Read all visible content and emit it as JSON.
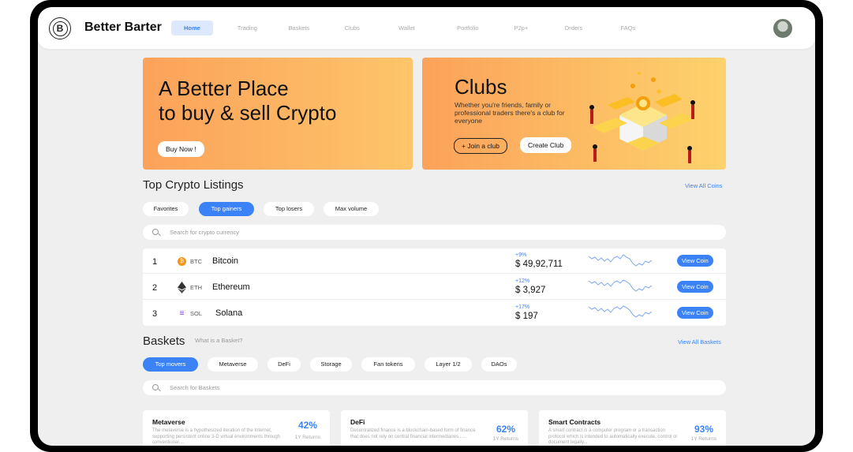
{
  "nav": {
    "logo_letter": "B",
    "brand": "Better Barter",
    "items": [
      "Home",
      "Trading",
      "Baskets",
      "Clubs",
      "Wallet",
      "Portfolio",
      "P2p+",
      "Orders",
      "FAQs"
    ]
  },
  "hero": {
    "title_line1": "A Better Place",
    "title_line2": "to buy & sell Crypto",
    "button": "Buy Now !"
  },
  "clubs": {
    "title": "Clubs",
    "description": "Whether you're friends, family or professional traders there's a club for everyone",
    "join_button": "+ Join a club",
    "create_button": "Create Club"
  },
  "listings": {
    "title": "Top Crypto Listings",
    "view_all": "View All Coins",
    "filters": [
      "Favorites",
      "Top gainers",
      "Top losers",
      "Max volume"
    ],
    "search_placeholder": "Search for crypto currency",
    "rows": [
      {
        "rank": "1",
        "symbol": "BTC",
        "name": "Bitcoin",
        "change": "+9%",
        "price": "$ 49,92,711",
        "button": "View Coin"
      },
      {
        "rank": "2",
        "symbol": "ETH",
        "name": "Ethereum",
        "change": "+12%",
        "price": "$ 3,927",
        "button": "View Coin"
      },
      {
        "rank": "3",
        "symbol": "SOL",
        "name": "Solana",
        "change": "+17%",
        "price": "$ 197",
        "button": "View Coin"
      }
    ]
  },
  "baskets": {
    "title": "Baskets",
    "subtitle": "What is a Basket?",
    "view_all": "View All Baskets",
    "filters": [
      "Top movers",
      "Metaverse",
      "DeFi",
      "Storage",
      "Fan tokens",
      "Layer 1/2",
      "DAOs"
    ],
    "search_placeholder": "Search for Baskets",
    "cards": [
      {
        "title": "Metaverse",
        "desc": "The metaverse is a hypothesized iteration of the Internet, supporting persistent online 3-D virtual environments through conventional....",
        "pct": "42%",
        "ret": "1Y Returns"
      },
      {
        "title": "DeFi",
        "desc": "Decentralized finance is a blockchain-based form of finance that does not rely on central financial intermediaries......",
        "pct": "62%",
        "ret": "1Y Returns"
      },
      {
        "title": "Smart Contracts",
        "desc": "A smart contract is a computer program or a transaction protocol which is intended to automatically execute, control or document legally...",
        "pct": "93%",
        "ret": "1Y Returns"
      }
    ]
  },
  "colors": {
    "accent": "#3b82f6",
    "hero_orange": "#fca25a",
    "hero_yellow": "#fdc56a",
    "btc": "#f7931a"
  }
}
